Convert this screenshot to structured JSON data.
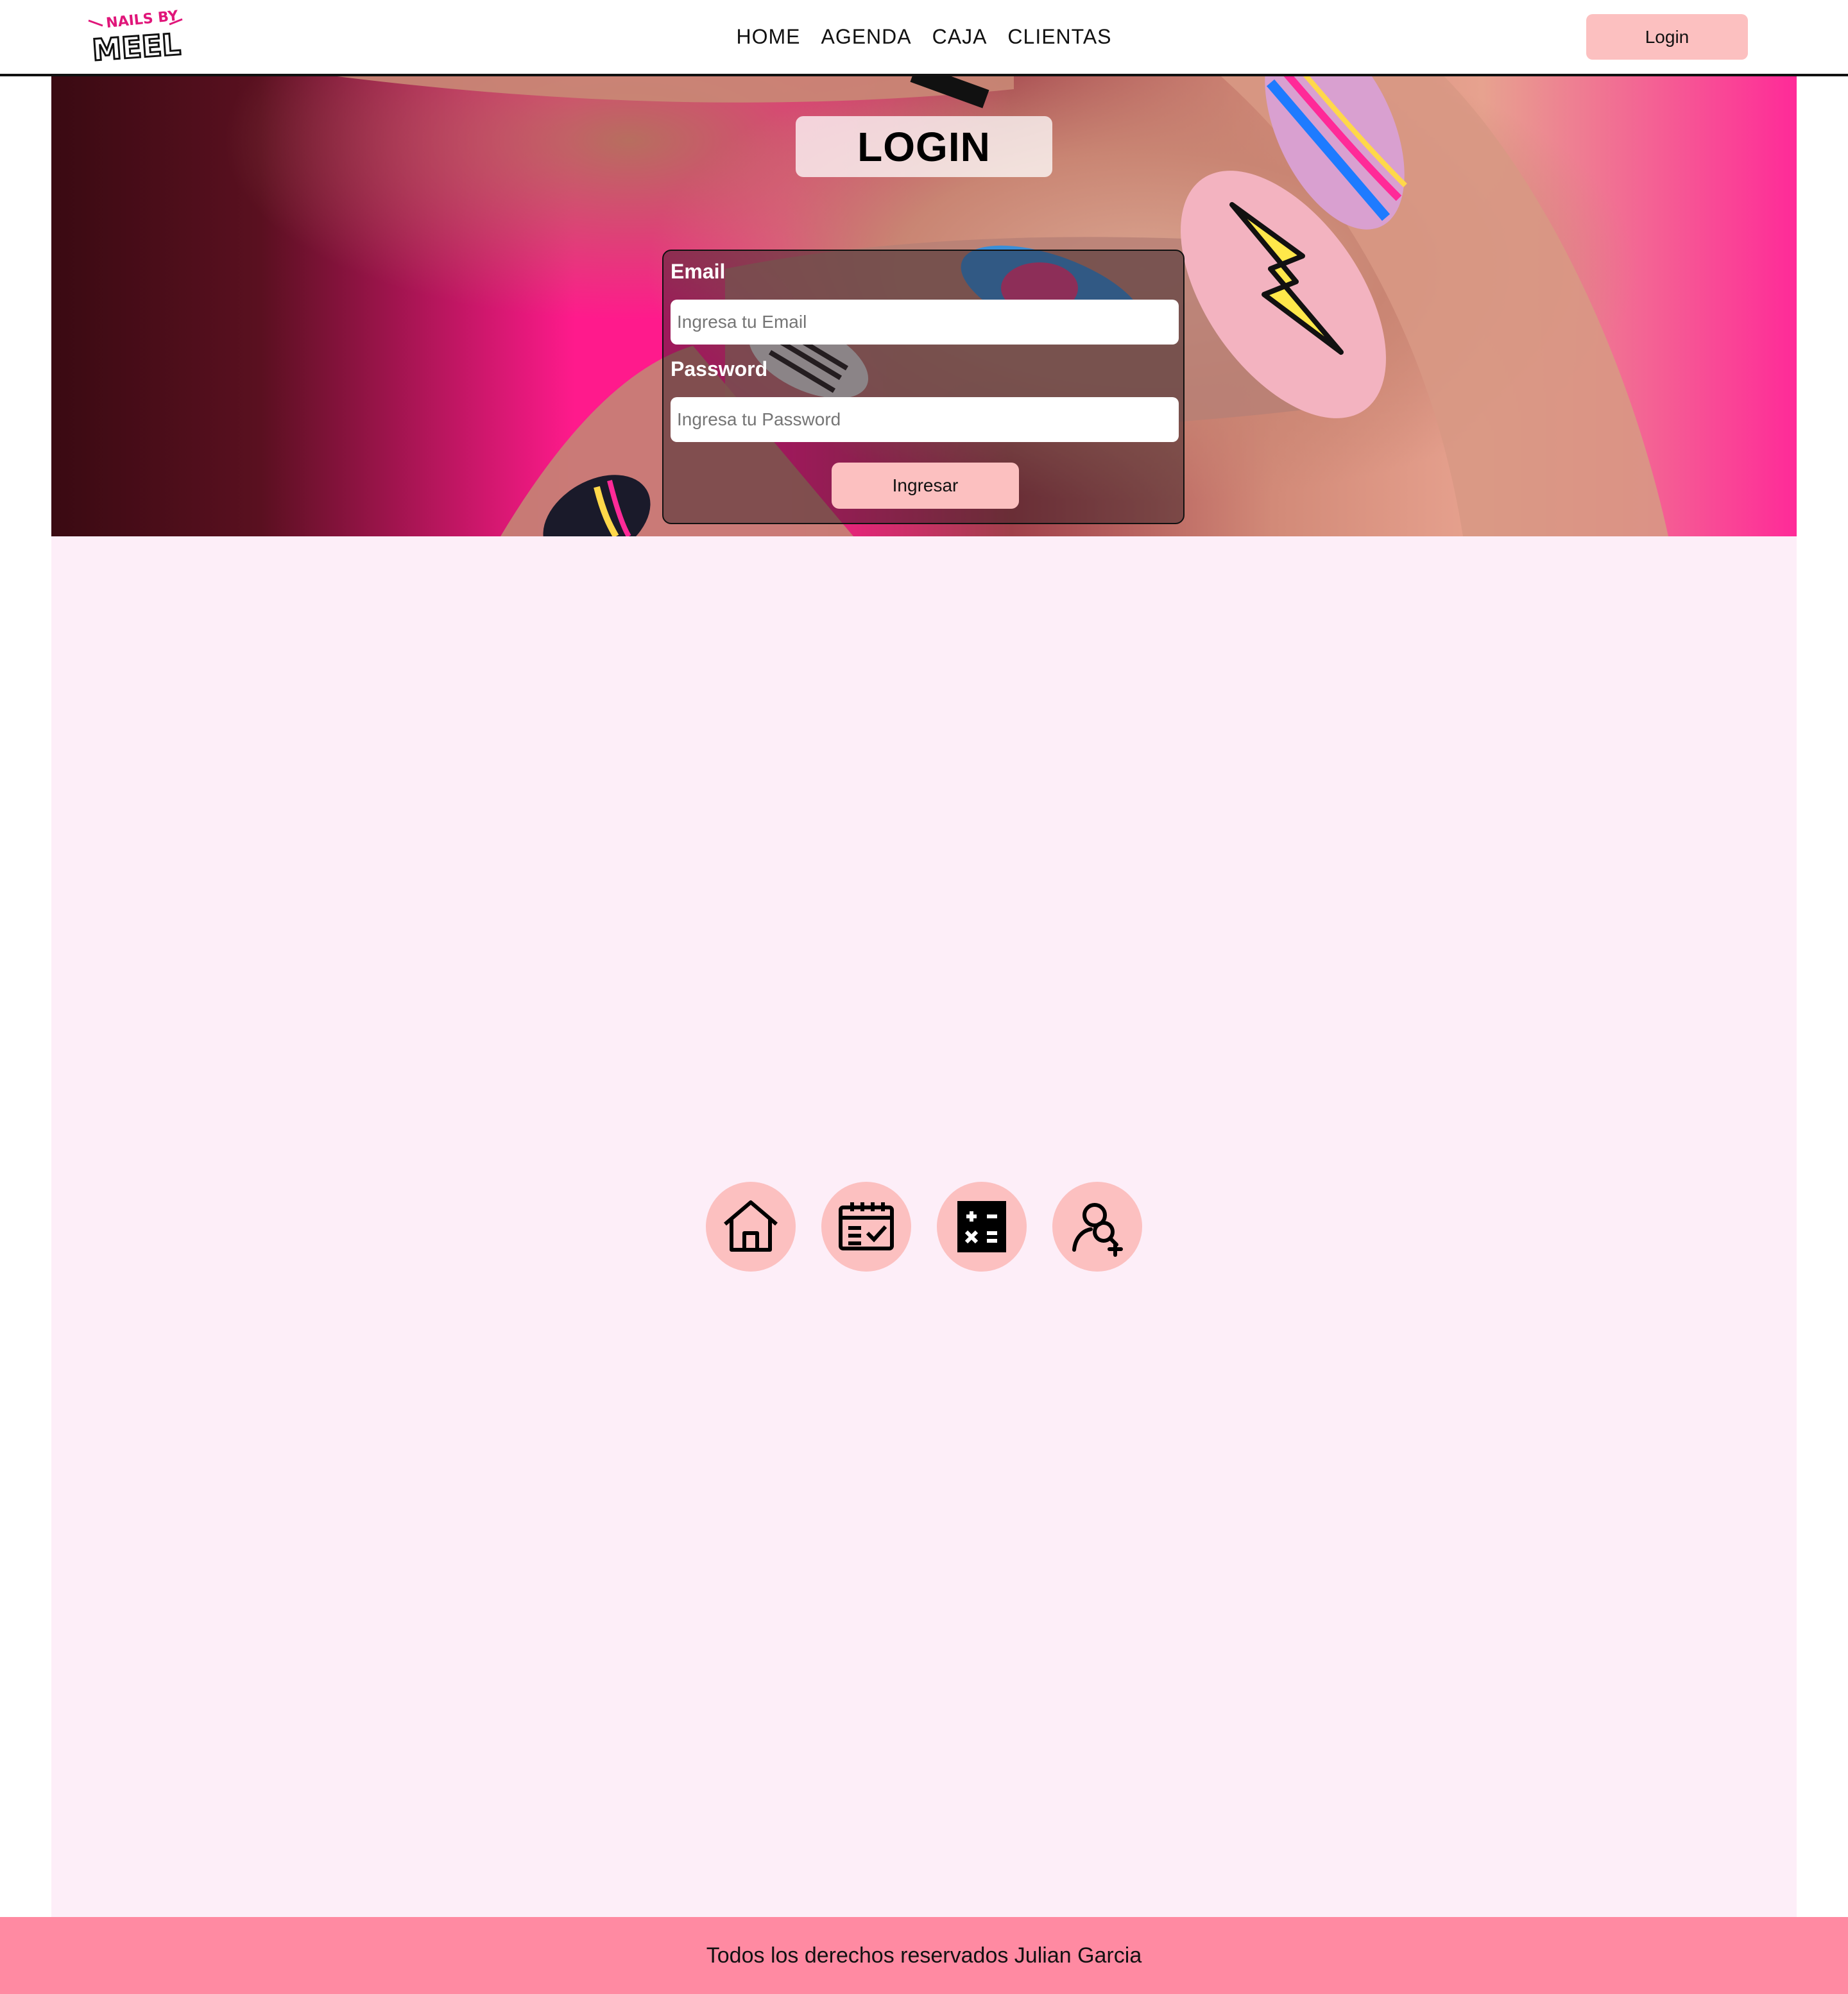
{
  "brand": {
    "logo_text_top": "NAILS BY",
    "logo_text_main": "MEEL"
  },
  "nav": {
    "links": [
      "HOME",
      "AGENDA",
      "CAJA",
      "CLIENTAS"
    ],
    "login_label": "Login"
  },
  "hero": {
    "title": "LOGIN"
  },
  "form": {
    "email_label": "Email",
    "email_placeholder": "Ingresa tu Email",
    "password_label": "Password",
    "password_placeholder": "Ingresa tu Password",
    "submit_label": "Ingresar"
  },
  "quick_nav": {
    "icons": [
      "home-icon",
      "calendar-check-icon",
      "calculator-icon",
      "add-user-icon"
    ]
  },
  "footer": {
    "text": "Todos los derechos reservados Julian Garcia"
  },
  "colors": {
    "accent_pink": "#fcc0c0",
    "footer_pink": "#ff8aa2",
    "page_background": "#fdeef8",
    "hero_magenta": "#ff1a8c"
  }
}
